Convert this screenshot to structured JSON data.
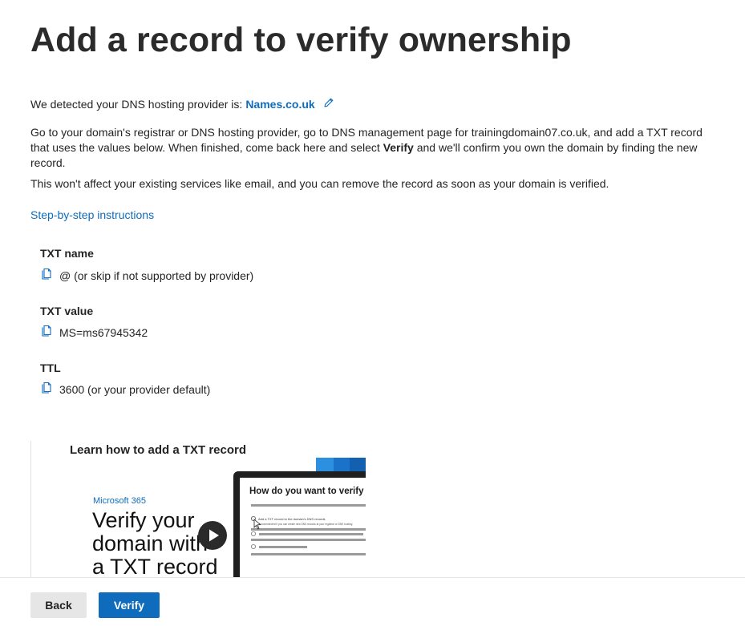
{
  "page": {
    "title": "Add a record to verify ownership"
  },
  "provider": {
    "prefix": "We detected your DNS hosting provider is:",
    "name": "Names.co.uk",
    "edit_icon": "pencil-icon"
  },
  "instructions": {
    "p1_part1": "Go to your domain's registrar or DNS hosting provider, go to DNS management page for trainingdomain07.co.uk, and add a TXT record that uses the values below. When finished, come back here and select ",
    "p1_bold": "Verify",
    "p1_part2": " and we'll confirm you own the domain by finding the new record.",
    "p2": "This won't affect your existing services like email, and you can remove the record as soon as your domain is verified.",
    "step_link": "Step-by-step instructions"
  },
  "record": {
    "fields": [
      {
        "label": "TXT name",
        "value": "@ (or skip if not supported by provider)",
        "icon": "copy-icon"
      },
      {
        "label": "TXT value",
        "value": "MS=ms67945342",
        "icon": "copy-icon"
      },
      {
        "label": "TTL",
        "value": "3600 (or your provider default)",
        "icon": "copy-icon"
      }
    ]
  },
  "video": {
    "title": "Learn how to add a TXT record",
    "brand": "Microsoft 365",
    "heading_lines": [
      "Verify your",
      "domain with",
      "a TXT record"
    ],
    "mock_question": "How do you want to verify",
    "mock_option_1": "Add a TXT record to the domain's DNS records",
    "mock_option_1_sub": "Recommended if you can create new DNS records at your registrar or DNS hosting",
    "play_icon": "play-icon",
    "colors": {
      "blue_1": "#2d8fe0",
      "blue_2": "#1a73c8",
      "blue_3": "#1360b0"
    }
  },
  "footer": {
    "back_label": "Back",
    "verify_label": "Verify"
  },
  "colors": {
    "accent": "#0f6cbd",
    "text": "#242424",
    "secondary_button": "#e6e6e6"
  }
}
